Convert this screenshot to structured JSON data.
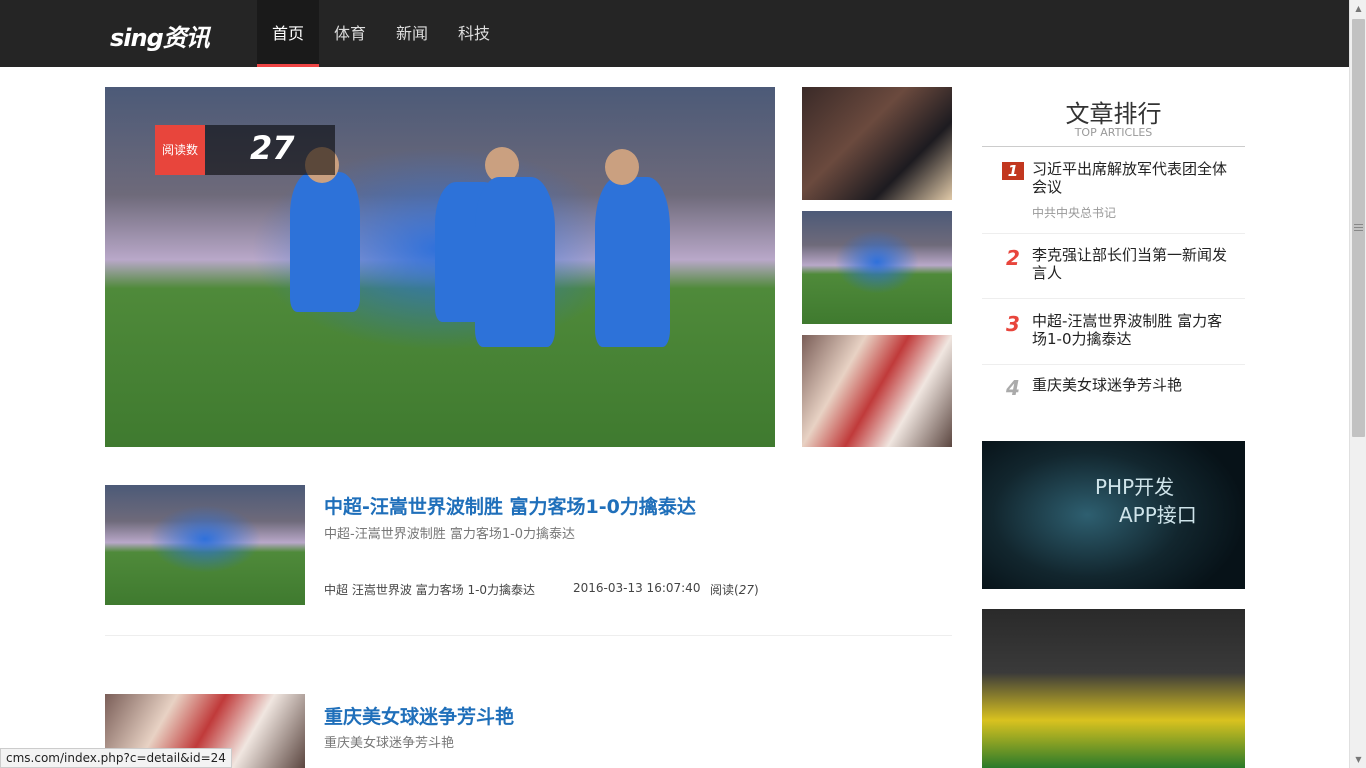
{
  "header": {
    "logo": "sing资讯",
    "nav": [
      "首页",
      "体育",
      "新闻",
      "科技"
    ]
  },
  "hero": {
    "badge_label": "阅读数",
    "badge_count": "27"
  },
  "articles": [
    {
      "title": "中超-汪嵩世界波制胜 富力客场1-0力擒泰达",
      "desc": "中超-汪嵩世界波制胜 富力客场1-0力擒泰达",
      "tags": "中超 汪嵩世界波 富力客场 1-0力擒泰达",
      "date": "2016-03-13 16:07:40",
      "read_label": "阅读(",
      "read_count": "27",
      "read_close": ")"
    },
    {
      "title": "重庆美女球迷争芳斗艳",
      "desc": "重庆美女球迷争芳斗艳"
    }
  ],
  "ranking": {
    "title": "文章排行",
    "subtitle": "TOP ARTICLES",
    "items": [
      {
        "num": "1",
        "text": "习近平出席解放军代表团全体会议",
        "note": "中共中央总书记"
      },
      {
        "num": "2",
        "text": "李克强让部长们当第一新闻发言人"
      },
      {
        "num": "3",
        "text": "中超-汪嵩世界波制胜 富力客场1-0力擒泰达"
      },
      {
        "num": "4",
        "text": "重庆美女球迷争芳斗艳"
      }
    ]
  },
  "ad": {
    "line1": "PHP开发",
    "line2": "APP接口"
  },
  "status": {
    "url": "cms.com/index.php?c=detail&id=24"
  },
  "colors": {
    "nav_bg": "#252525",
    "accent_red": "#e8453c",
    "title_blue": "#1f6fba"
  }
}
